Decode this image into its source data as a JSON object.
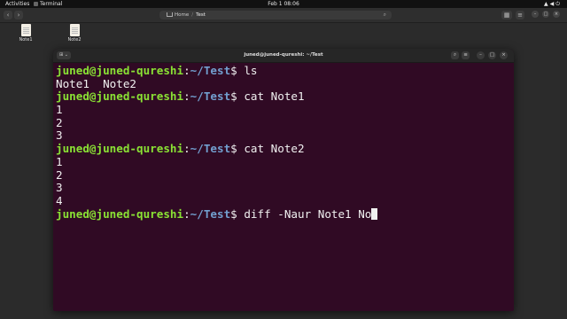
{
  "topbar": {
    "activities": "Activities",
    "app_name": "Terminal",
    "clock": "Feb 1  08:06"
  },
  "file_manager": {
    "path_home": "Home",
    "path_current": "Test"
  },
  "desktop_files": [
    {
      "name": "Note1"
    },
    {
      "name": "Note2"
    }
  ],
  "terminal": {
    "title": "juned@juned-qureshi: ~/Test",
    "prompt_user": "juned@juned-qureshi",
    "prompt_sep": ":",
    "prompt_path": "~/Test",
    "prompt_end": "$ ",
    "lines": [
      {
        "cmd": "ls"
      },
      {
        "out": "Note1  Note2"
      },
      {
        "cmd": "cat Note1"
      },
      {
        "out": "1"
      },
      {
        "out": "2"
      },
      {
        "out": "3"
      },
      {
        "cmd": "cat Note2"
      },
      {
        "out": "1"
      },
      {
        "out": "2"
      },
      {
        "out": "3"
      },
      {
        "out": "4"
      },
      {
        "cmd": "diff -Naur Note1 No",
        "cursor": true
      }
    ]
  }
}
